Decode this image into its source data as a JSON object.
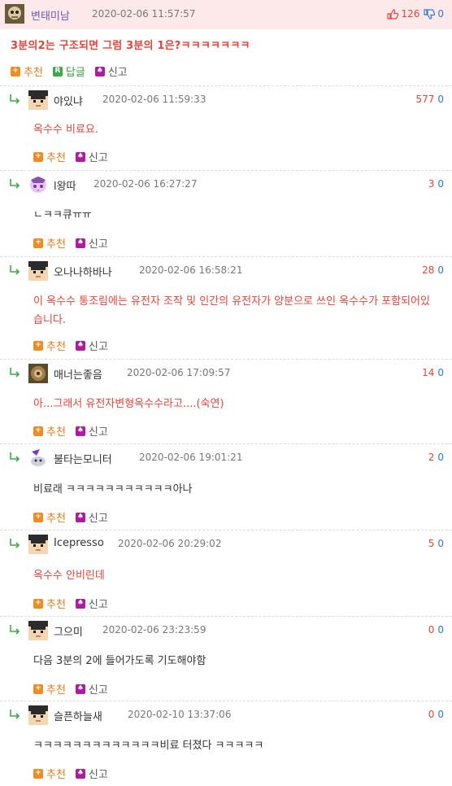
{
  "post": {
    "author": "변태미남",
    "date": "2020-02-06 11:57:57",
    "upvotes": "126",
    "downvotes": "0",
    "title": "3분의2는 구조되면 그럼 3분의 1은?ㅋㅋㅋㅋㅋㅋㅋ",
    "actions": {
      "recommend": "추천",
      "reply": "답글",
      "report": "신고"
    }
  },
  "comments": [
    {
      "author": "야있냐",
      "date": "2020-02-06 11:59:33",
      "up": "577",
      "down": "0",
      "text": "옥수수 비료요.",
      "red": true
    },
    {
      "author": "l왕따",
      "date": "2020-02-06 16:27:27",
      "up": "3",
      "down": "0",
      "text": "ㄴㅋㅋ큐ㅠㅠ",
      "red": false
    },
    {
      "author": "오나나하바나",
      "date": "2020-02-06 16:58:21",
      "up": "28",
      "down": "0",
      "text": "이 옥수수 통조림에는 유전자 조작 및 인간의 유전자가 양분으로 쓰인 옥수수가 포함되어있습니다.",
      "red": true
    },
    {
      "author": "매너는좋음",
      "date": "2020-02-06 17:09:57",
      "up": "14",
      "down": "0",
      "text": "아...그래서 유전자변형옥수수라고....(숙연)",
      "red": true
    },
    {
      "author": "불타는모니터",
      "date": "2020-02-06 19:01:21",
      "up": "2",
      "down": "0",
      "text": "비료래 ㅋㅋㅋㅋㅋㅋㅋㅋㅋㅋㅋ아나",
      "red": false
    },
    {
      "author": "Icepresso",
      "date": "2020-02-06 20:29:02",
      "up": "5",
      "down": "0",
      "text": "옥수수 안비린데",
      "red": true
    },
    {
      "author": "그으미",
      "date": "2020-02-06 23:23:59",
      "up": "0",
      "down": "0",
      "text": "다음 3분의 2에 들어가도록 기도해야함",
      "red": false
    },
    {
      "author": "슬픈하늘새",
      "date": "2020-02-10 13:37:06",
      "up": "0",
      "down": "0",
      "text": "ㅋㅋㅋㅋㅋㅋㅋㅋㅋㅋㅋㅋㅋ비료 터졌다 ㅋㅋㅋㅋㅋ",
      "red": false
    }
  ],
  "comment_actions": {
    "recommend": "추천",
    "report": "신고"
  },
  "icons": {
    "thumbs_up": "thumbs-up-icon",
    "thumbs_down": "thumbs-down-icon",
    "reply_arrow": "reply-arrow-icon",
    "recommend": "plus-icon",
    "reply": "reply-r-icon",
    "report": "bell-icon"
  },
  "colors": {
    "accent_red": "#e0463b",
    "downvote_blue": "#2f7ad1",
    "header_bg": "#fde9ea",
    "author_purple": "#6b5bb8",
    "recommend_orange": "#f08c24",
    "reply_green": "#3fa84a",
    "report_magenta": "#b01ca0"
  }
}
